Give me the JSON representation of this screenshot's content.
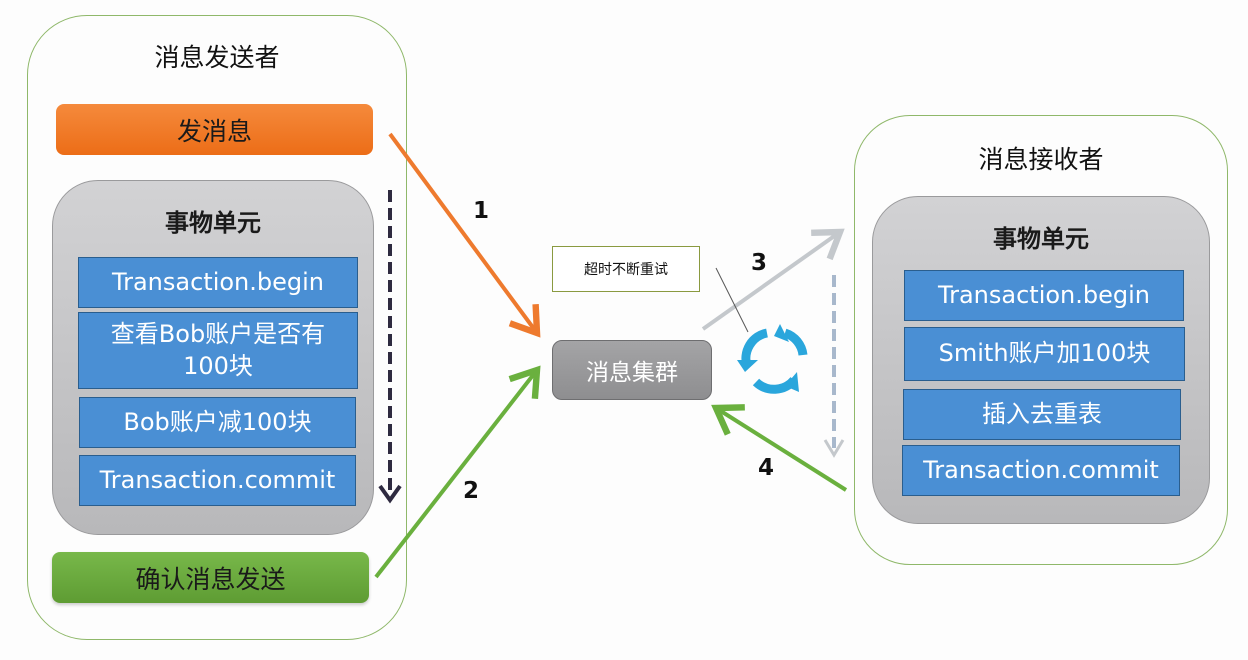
{
  "sender": {
    "title": "消息发送者",
    "send_button": "发消息",
    "unit": {
      "title": "事物单元",
      "steps": [
        "Transaction.begin",
        "查看Bob账户是否有100块",
        "Bob账户减100块",
        "Transaction.commit"
      ]
    },
    "confirm_button": "确认消息发送"
  },
  "cluster": {
    "label": "消息集群"
  },
  "retry_note": "超时不断重试",
  "receiver": {
    "title": "消息接收者",
    "unit": {
      "title": "事物单元",
      "steps": [
        "Transaction.begin",
        "Smith账户加100块",
        "插入去重表",
        "Transaction.commit"
      ]
    }
  },
  "arrows": [
    {
      "label": "1",
      "from": "发消息",
      "to": "消息集群",
      "color": "#ee7a2e"
    },
    {
      "label": "2",
      "from": "确认消息发送",
      "to": "消息集群",
      "color": "#6ab03e"
    },
    {
      "label": "3",
      "from": "消息集群",
      "to": "消息接收者",
      "color": "#c4c8cc"
    },
    {
      "label": "4",
      "from": "消息接收者",
      "to": "消息集群",
      "color": "#6ab03e"
    }
  ],
  "colors": {
    "orange": "#ee7a2e",
    "green": "#6ab03e",
    "step_blue": "#4a8fd4",
    "cycle_blue": "#2aa6dc"
  }
}
